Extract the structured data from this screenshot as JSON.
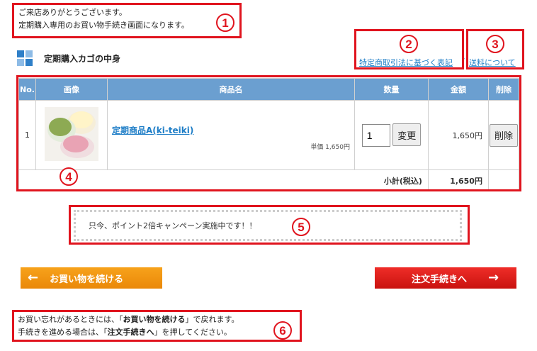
{
  "messages": {
    "welcome_line1": "ご来店ありがとうございます。",
    "welcome_line2": "定期購入専用のお買い物手続き画面になります。"
  },
  "cart": {
    "title": "定期購入カゴの中身",
    "link_tokusho": "特定商取引法に基づく表記",
    "link_shipping": "送料について",
    "headers": [
      "No.",
      "画像",
      "商品名",
      "数量",
      "金額",
      "削除"
    ],
    "rows": [
      {
        "no": "1",
        "product_name": "定期商品A(ki-teiki)",
        "unit_price": "単価 1,650円",
        "qty": "1",
        "change_label": "変更",
        "amount": "1,650円",
        "delete_label": "削除"
      }
    ],
    "subtotal_label": "小計(税込)",
    "subtotal_value": "1,650円"
  },
  "campaign_text": "只今、ポイント2倍キャンペーン実施中です！！",
  "buttons": {
    "continue_label": "お買い物を続ける",
    "checkout_label": "注文手続きへ"
  },
  "bottom": {
    "line1_pre": "お買い忘れがあるときには、「",
    "line1_bold": "お買い物を続ける",
    "line1_post": "」で戻れます。",
    "line2_pre": "手続きを進める場合は、「",
    "line2_bold": "注文手続きへ",
    "line2_post": "」を押してください。"
  },
  "callouts": [
    "1",
    "2",
    "3",
    "4",
    "5",
    "6"
  ],
  "colors": {
    "accent_red": "#e0141e",
    "header_blue": "#6b9fd0",
    "link_blue": "#1f7ec7",
    "orange": "#f39800"
  }
}
